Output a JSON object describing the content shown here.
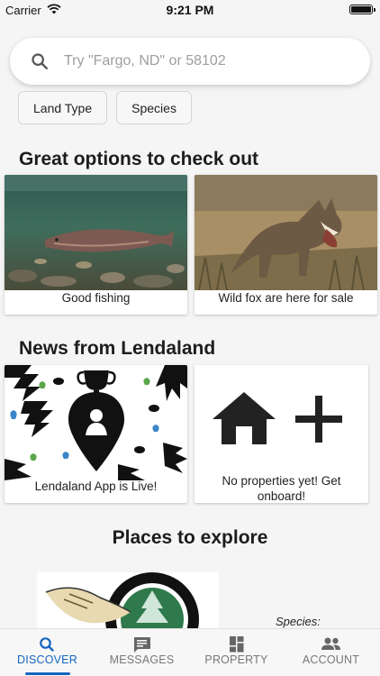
{
  "status_bar": {
    "carrier": "Carrier",
    "time": "9:21 PM"
  },
  "search": {
    "placeholder": "Try \"Fargo, ND\" or 58102"
  },
  "filters": [
    {
      "label": "Land Type"
    },
    {
      "label": "Species"
    }
  ],
  "sections": {
    "options": {
      "title": "Great options to check out",
      "cards": [
        {
          "caption": "Good fishing"
        },
        {
          "caption": "Wild fox are here for sale"
        }
      ]
    },
    "news": {
      "title": "News from Lendaland",
      "cards": [
        {
          "caption": "Lendaland App is Live!"
        },
        {
          "caption": "No properties yet! Get onboard!"
        }
      ]
    },
    "explore": {
      "title": "Places to explore",
      "species_label": "Species:"
    }
  },
  "tabs": [
    {
      "label": "DISCOVER",
      "icon": "search-icon",
      "active": true
    },
    {
      "label": "MESSAGES",
      "icon": "chat-icon",
      "active": false
    },
    {
      "label": "PROPERTY",
      "icon": "dashboard-icon",
      "active": false
    },
    {
      "label": "ACCOUNT",
      "icon": "people-icon",
      "active": false
    }
  ],
  "colors": {
    "accent": "#1565c0",
    "inactive_tab": "#777777"
  }
}
